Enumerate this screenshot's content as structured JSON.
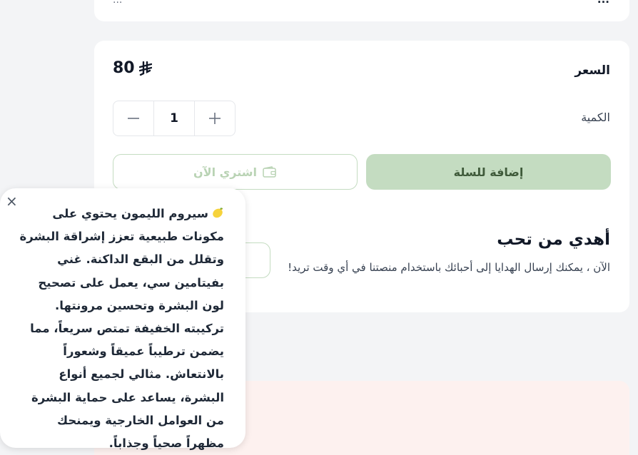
{
  "top_card": {
    "right_text": "...",
    "left_text": "..."
  },
  "price": {
    "label": "السعر",
    "value": "80",
    "currency_symbol": "⃁"
  },
  "quantity": {
    "label": "الكمية",
    "value": "1",
    "minus": "−",
    "plus": "+"
  },
  "actions": {
    "add_to_cart": "إضافة للسلة",
    "buy_now": "اشتري الآن"
  },
  "gift": {
    "title": "أهدي من تحب",
    "description": "الآن ، يمكنك إرسال الهدايا إلى أحبائك باستخدام منصتنا في أي وقت تريد!"
  },
  "popup": {
    "close": "×",
    "text": "سيروم الليمون يحتوي على مكونات طبيعية تعزز إشراقة البشرة وتقلل من البقع الداكنة. غني بفيتامين سي، يعمل على تصحيح لون البشرة وتحسين مرونتها. تركيبته الخفيفة تمتص سريعاً، مما يضمن ترطيباً عميقاً وشعوراً بالانتعاش. مثالي لجميع أنواع البشرة، يساعد على حماية البشرة من العوامل الخارجية ويمنحك مظهراً صحياً وجذاباً."
  },
  "colors": {
    "accent_green": "#c4dcc1",
    "pink_section": "#fdf1ef",
    "background": "#f3f4f6"
  }
}
